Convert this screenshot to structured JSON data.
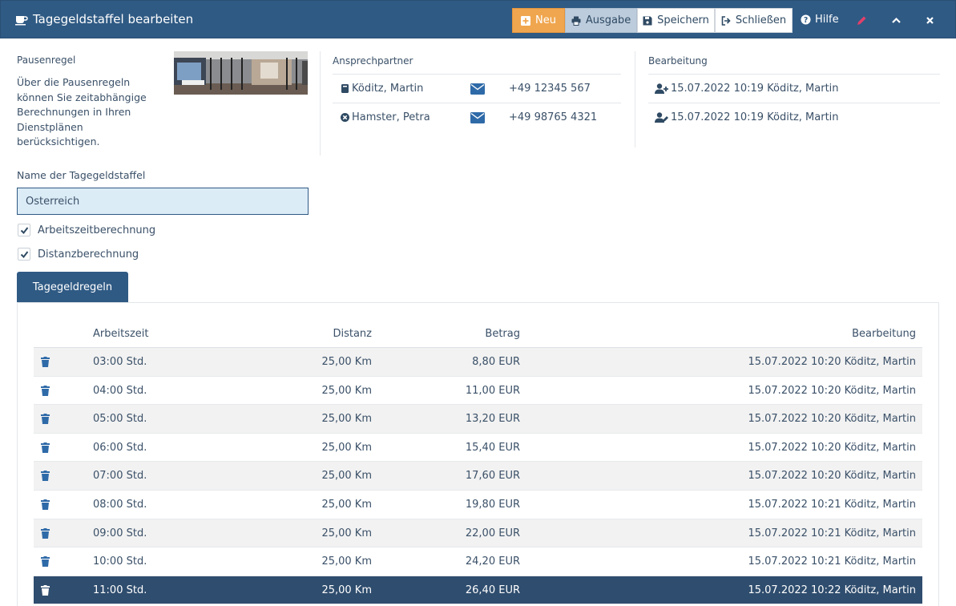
{
  "window": {
    "title": "Tagegeldstaffel bearbeiten"
  },
  "toolbar": {
    "neu_label": "Neu",
    "ausgabe_label": "Ausgabe",
    "speichern_label": "Speichern",
    "schliessen_label": "Schließen",
    "hilfe_label": "Hilfe"
  },
  "pausenregel": {
    "heading": "Pausenregel",
    "description": "Über die Pausenregeln können Sie zeitabhängige Berechnungen in Ihren Dienstplänen berücksichtigen."
  },
  "ansprechpartner": {
    "heading": "Ansprechpartner",
    "contacts": [
      {
        "name": "Köditz, Martin",
        "phone": "+49 12345 567",
        "icon": "address-book-icon"
      },
      {
        "name": "Hamster, Petra",
        "phone": "+49 98765 4321",
        "icon": "circle-x-icon"
      }
    ]
  },
  "bearbeitung": {
    "heading": "Bearbeitung",
    "entries": [
      {
        "text": "15.07.2022 10:19 Köditz, Martin",
        "icon": "user-plus-icon"
      },
      {
        "text": "15.07.2022 10:19 Köditz, Martin",
        "icon": "user-edit-icon"
      }
    ]
  },
  "form": {
    "name_label": "Name der Tagegeldstaffel",
    "name_value": "Österreich",
    "checkboxes": [
      {
        "label": "Arbeitszeitberechnung",
        "checked": true
      },
      {
        "label": "Distanzberechnung",
        "checked": true
      }
    ]
  },
  "tabs": [
    {
      "label": "Tagegeldregeln",
      "active": true
    }
  ],
  "table": {
    "columns": [
      "Arbeitszeit",
      "Distanz",
      "Betrag",
      "Bearbeitung"
    ],
    "rows": [
      {
        "arbeitszeit": "03:00 Std.",
        "distanz": "25,00 Km",
        "betrag": "8,80 EUR",
        "bearbeitung": "15.07.2022 10:20 Köditz, Martin"
      },
      {
        "arbeitszeit": "04:00 Std.",
        "distanz": "25,00 Km",
        "betrag": "11,00 EUR",
        "bearbeitung": "15.07.2022 10:20 Köditz, Martin"
      },
      {
        "arbeitszeit": "05:00 Std.",
        "distanz": "25,00 Km",
        "betrag": "13,20 EUR",
        "bearbeitung": "15.07.2022 10:20 Köditz, Martin"
      },
      {
        "arbeitszeit": "06:00 Std.",
        "distanz": "25,00 Km",
        "betrag": "15,40 EUR",
        "bearbeitung": "15.07.2022 10:20 Köditz, Martin"
      },
      {
        "arbeitszeit": "07:00 Std.",
        "distanz": "25,00 Km",
        "betrag": "17,60 EUR",
        "bearbeitung": "15.07.2022 10:20 Köditz, Martin"
      },
      {
        "arbeitszeit": "08:00 Std.",
        "distanz": "25,00 Km",
        "betrag": "19,80 EUR",
        "bearbeitung": "15.07.2022 10:21 Köditz, Martin"
      },
      {
        "arbeitszeit": "09:00 Std.",
        "distanz": "25,00 Km",
        "betrag": "22,00 EUR",
        "bearbeitung": "15.07.2022 10:21 Köditz, Martin"
      },
      {
        "arbeitszeit": "10:00 Std.",
        "distanz": "25,00 Km",
        "betrag": "24,20 EUR",
        "bearbeitung": "15.07.2022 10:21 Köditz, Martin"
      },
      {
        "arbeitszeit": "11:00 Std.",
        "distanz": "25,00 Km",
        "betrag": "26,40 EUR",
        "bearbeitung": "15.07.2022 10:22 Köditz, Martin",
        "selected": true
      }
    ]
  },
  "colors": {
    "header": "#2f5a84",
    "accent_orange": "#f0a64f",
    "selected_row": "#2f4d6e",
    "icon_blue": "#2f6aa8",
    "edit_red": "#e0406a"
  }
}
